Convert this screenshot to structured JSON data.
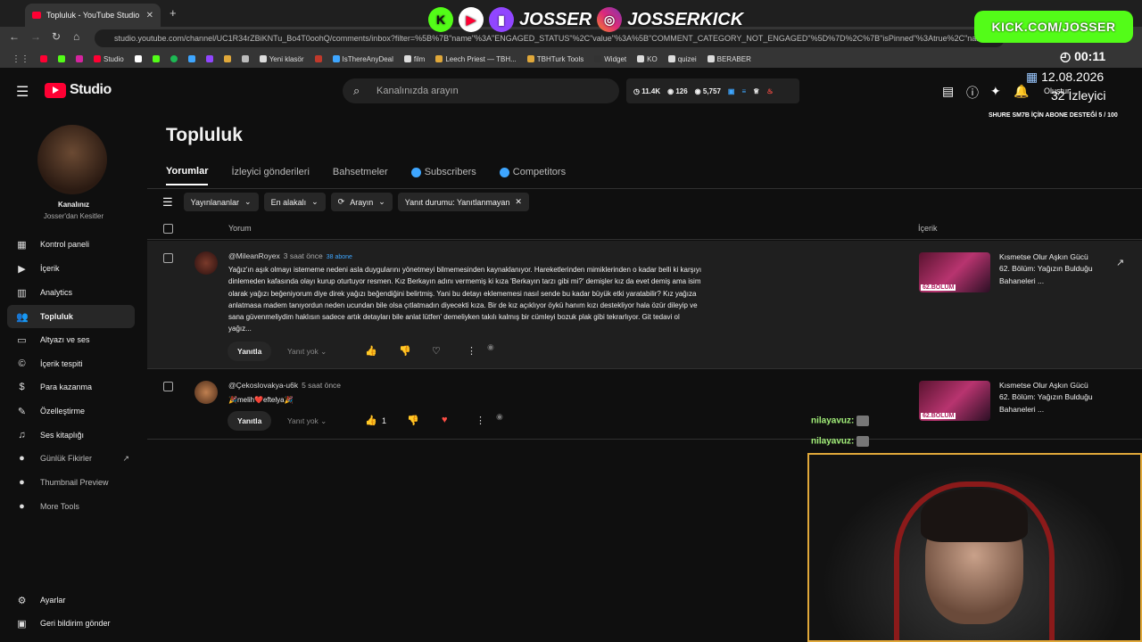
{
  "browser": {
    "tab_title": "Topluluk - YouTube Studio",
    "url": "studio.youtube.com/channel/UC1R34rZBiKNTu_Bo4T0oohQ/comments/inbox?filter=%5B%7B\"name\"%3A\"ENGAGED_STATUS\"%2C\"value\"%3A%5B\"COMMENT_CATEGORY_NOT_ENGAGED\"%5D%7D%2C%7B\"isPinned\"%3Atrue%2C\"nam",
    "bookmarks": [
      "Studio",
      "Yeni klasör",
      "IsThereAnyDeal",
      "film",
      "Leech Priest — TBH...",
      "TBHTurk Tools",
      "Widget",
      "KO",
      "quizei",
      "BERABER"
    ]
  },
  "overlay": {
    "name1": "JOSSER",
    "name2": "JOSSERKICK",
    "kick_url": "KICK.COM/JOSSER",
    "clock": "00:11",
    "date": "12.08.2026",
    "viewers": "32 İzleyici",
    "sub_goal": "SHURE SM7B İÇİN ABONE DESTEĞİ 5 / 100",
    "chat": [
      {
        "user": "nilayavuz:"
      },
      {
        "user": "nilayavuz:"
      }
    ]
  },
  "header": {
    "logo": "Studio",
    "search_placeholder": "Kanalınızda arayın",
    "stats": [
      "11.4K",
      "126",
      "5,757"
    ],
    "create_label": "Oluştur"
  },
  "sidebar": {
    "channel_label": "Kanalınız",
    "channel_name": "Josser'dan Kesitler",
    "items": [
      {
        "label": "Kontrol paneli",
        "icon": "dashboard-icon"
      },
      {
        "label": "İçerik",
        "icon": "content-icon"
      },
      {
        "label": "Analytics",
        "icon": "analytics-icon"
      },
      {
        "label": "Topluluk",
        "icon": "community-icon"
      },
      {
        "label": "Altyazı ve ses",
        "icon": "subtitles-icon"
      },
      {
        "label": "İçerik tespiti",
        "icon": "copyright-icon"
      },
      {
        "label": "Para kazanma",
        "icon": "money-icon"
      },
      {
        "label": "Özelleştirme",
        "icon": "customize-icon"
      },
      {
        "label": "Ses kitaplığı",
        "icon": "audio-library-icon"
      },
      {
        "label": "Günlük Fikirler",
        "icon": "extension-icon"
      },
      {
        "label": "Thumbnail Preview",
        "icon": "extension-icon"
      },
      {
        "label": "More Tools",
        "icon": "extension-icon"
      }
    ],
    "settings": "Ayarlar",
    "feedback": "Geri bildirim gönder"
  },
  "main": {
    "title": "Topluluk",
    "tabs": [
      "Yorumlar",
      "İzleyici gönderileri",
      "Bahsetmeler",
      "Subscribers",
      "Competitors"
    ],
    "filters": [
      "Yayınlananlar",
      "En alakalı",
      "Arayın",
      "Yanıt durumu: Yanıtlanmayan"
    ],
    "col_comment": "Yorum",
    "col_content": "İçerik",
    "reply_label": "Yanıtla",
    "no_reply_label": "Yanıt yok",
    "comments": [
      {
        "author": "@MileanRoyex",
        "time": "3 saat önce",
        "badge": "38 abone",
        "lines": [
          "Yağız'ın aşık olmayı istememe nedeni asla duygularını yönetmeyi bilmemesinden kaynaklanıyor. Hareketlerinden mimiklerinden o kadar belli ki karşıyı",
          "dinlemeden kafasında olayı kurup oturtuyor resmen. Kız Berkayın adını vermemiş ki kıza 'Berkayın tarzı gibi mi?' demişler kız da evet demiş ama isim",
          "olarak yağızı beğeniyorum diye direk yağızı beğendiğini belirtmiş. Yani bu detayı eklememesi nasıl sende bu kadar büyük etki yaratabilir? Kız yağıza",
          "anlatmasa madem tanıyordun neden ucundan bile olsa çıtlatmadın diyecekti kıza.  Bir de kız açıklıyor öykü hanım kızı destekliyor hala  özür dileyip ve",
          "sana güvenmeliydim haklısın sadece artık detayları bile anlat lütfen' demeliyken takılı kalmış bir cümleyi bozuk plak gibi tekrarlıyor. Git tedavi ol",
          "yağız..."
        ],
        "likes": "",
        "video": "Kısmetse Olur Aşkın Gücü 62. Bölüm: Yağızın Bulduğu Bahaneleri ..."
      },
      {
        "author": "@Çekoslovakya-u6k",
        "time": "5 saat önce",
        "text": "🎉melih❤️eftelya🎉",
        "likes": "1",
        "video": "Kısmetse Olur Aşkın Gücü 62. Bölüm: Yağızın Bulduğu Bahaneleri ..."
      }
    ],
    "thumb_label": "62.BÖLÜM"
  }
}
